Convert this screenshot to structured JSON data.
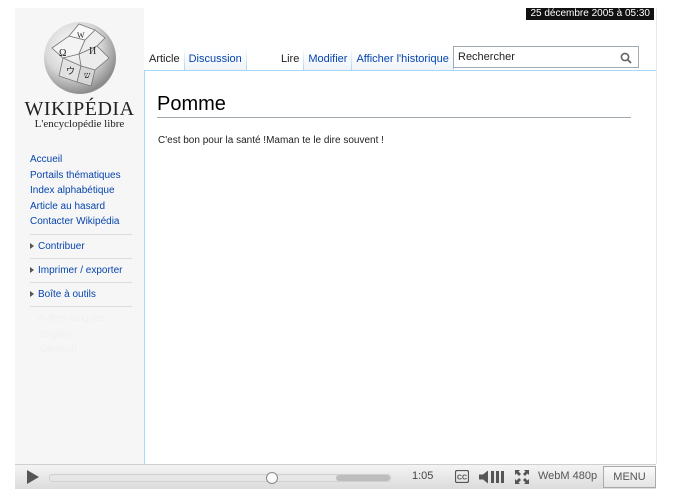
{
  "timestamp": "25 décembre 2005 à 05:30",
  "logo": {
    "wordmark": "WIKIPÉDIA",
    "tagline": "L'encyclopédie libre"
  },
  "sidebar": {
    "links": [
      "Accueil",
      "Portails thématiques",
      "Index alphabétique",
      "Article au hasard",
      "Contacter Wikipédia"
    ],
    "sections": [
      "Contribuer",
      "Imprimer / exporter",
      "Boîte à outils"
    ],
    "faded": [
      "Autres langues",
      "English",
      "Deutsch"
    ]
  },
  "tabs": {
    "left": [
      "Article",
      "Discussion"
    ],
    "right": [
      "Lire",
      "Modifier",
      "Afficher l'historique"
    ]
  },
  "search": {
    "placeholder": "Rechercher"
  },
  "article": {
    "title": "Pomme",
    "text": "C'est bon pour la santé !Maman te le dire souvent !"
  },
  "player": {
    "time": "1:05",
    "format": "WebM 480p",
    "menu_label": "MENU",
    "progress": 0.65,
    "buffered_start": 0.84,
    "buffered_end": 1.0,
    "icons": [
      "play-icon",
      "closed-captions-icon",
      "volume-icon",
      "fullscreen-icon"
    ]
  },
  "colors": {
    "link": "#0645ad",
    "tab_border": "#a7d7f9",
    "sidebar_bg": "#f6f6f6"
  }
}
